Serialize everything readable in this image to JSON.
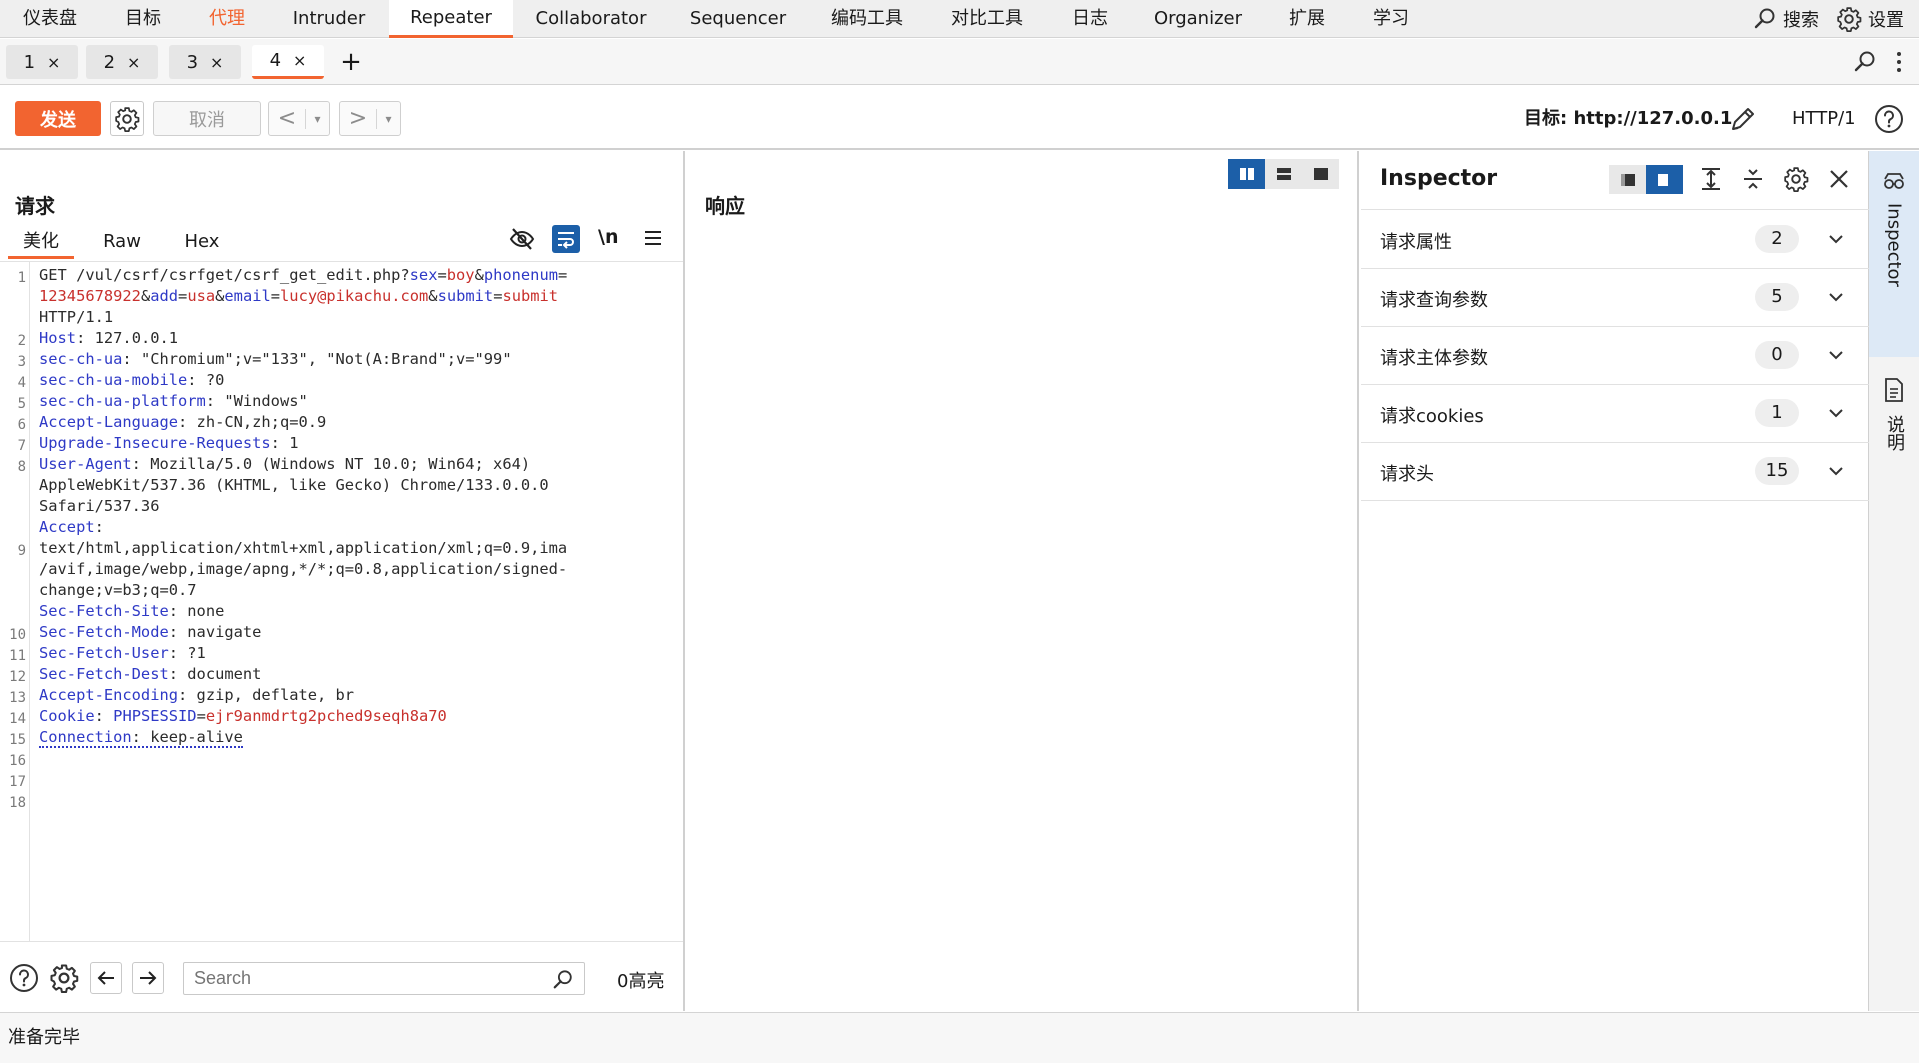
{
  "menu": {
    "items": [
      "仪表盘",
      "目标",
      "代理",
      "Intruder",
      "Repeater",
      "Collaborator",
      "Sequencer",
      "编码工具",
      "对比工具",
      "日志",
      "Organizer",
      "扩展",
      "学习"
    ],
    "search_label": "搜索",
    "settings_label": "设置",
    "accent_color": "#f26430"
  },
  "tabs": {
    "items": [
      "1",
      "2",
      "3",
      "4"
    ],
    "close_glyph": "×",
    "add_glyph": "+"
  },
  "toolbar": {
    "send_label": "发送",
    "cancel_label": "取消",
    "back_glyph": "<",
    "forward_glyph": ">",
    "dropdown_glyph": "▾",
    "target_text": "目标: http://127.0.0.1",
    "http_version": "HTTP/1"
  },
  "request": {
    "title": "请求",
    "subtabs": [
      "美化",
      "Raw",
      "Hex"
    ],
    "newline_toggle": "\\n",
    "line_numbers": [
      "1",
      "2",
      "3",
      "4",
      "5",
      "6",
      "7",
      "8",
      "9",
      "10",
      "11",
      "12",
      "13",
      "14",
      "15",
      "16",
      "17",
      "18"
    ],
    "lines": {
      "l1a_method": "GET ",
      "l1a_path": "/vul/csrf/csrfget/csrf_get_edit.php?",
      "p_sex_k": "sex",
      "p_sex_v": "boy",
      "p_phone_k": "phonenum",
      "p_phone_v": "12345678922",
      "p_add_k": "add",
      "p_add_v": "usa",
      "p_email_k": "email",
      "p_email_v": "lucy@pikachu.com",
      "p_submit_k": "submit",
      "p_submit_v": "submit",
      "amp": "&",
      "eq": "=",
      "l1c": "HTTP/1.1",
      "h_host_k": "Host",
      "h_host_v": " 127.0.0.1",
      "h_ua_k": "sec-ch-ua",
      "h_ua_v": " \"Chromium\";v=\"133\", \"Not(A:Brand\";v=\"99\"",
      "h_mobile_k": "sec-ch-ua-mobile",
      "h_mobile_v": " ?0",
      "h_platform_k": "sec-ch-ua-platform",
      "h_platform_v": " \"Windows\"",
      "h_lang_k": "Accept-Language",
      "h_lang_v": " zh-CN,zh;q=0.9",
      "h_uir_k": "Upgrade-Insecure-Requests",
      "h_uir_v": " 1",
      "h_agent_k": "User-Agent",
      "h_agent_v1": " Mozilla/5.0 (Windows NT 10.0; Win64; x64)",
      "h_agent_v2": "AppleWebKit/537.36 (KHTML, like Gecko) Chrome/133.0.0.0",
      "h_agent_v3": "Safari/537.36",
      "h_accept_k": "Accept",
      "h_accept_v1": "text/html,application/xhtml+xml,application/xml;q=0.9,ima",
      "h_accept_v2": "/avif,image/webp,image/apng,*/*;q=0.8,application/signed-",
      "h_accept_v3": "change;v=b3;q=0.7",
      "h_site_k": "Sec-Fetch-Site",
      "h_site_v": " none",
      "h_mode_k": "Sec-Fetch-Mode",
      "h_mode_v": " navigate",
      "h_user_k": "Sec-Fetch-User",
      "h_user_v": " ?1",
      "h_dest_k": "Sec-Fetch-Dest",
      "h_dest_v": " document",
      "h_enc_k": "Accept-Encoding",
      "h_enc_v": " gzip, deflate, br",
      "h_cookie_k": "Cookie",
      "h_cookie_name": "PHPSESSID",
      "h_cookie_val": "ejr9anmdrtg2pched9seqh8a70",
      "h_conn_k": "Connection",
      "h_conn_v": " keep-alive",
      "colon": ":"
    },
    "search_placeholder": "Search",
    "highlight_count": "0高亮"
  },
  "response": {
    "title": "响应"
  },
  "inspector": {
    "title": "Inspector",
    "rows": [
      {
        "label": "请求属性",
        "count": "2"
      },
      {
        "label": "请求查询参数",
        "count": "5"
      },
      {
        "label": "请求主体参数",
        "count": "0"
      },
      {
        "label": "请求cookies",
        "count": "1"
      },
      {
        "label": "请求头",
        "count": "15"
      }
    ]
  },
  "side_rail": {
    "inspector_label": "Inspector",
    "notes_label": "说明"
  },
  "status": {
    "text": "准备完毕"
  }
}
